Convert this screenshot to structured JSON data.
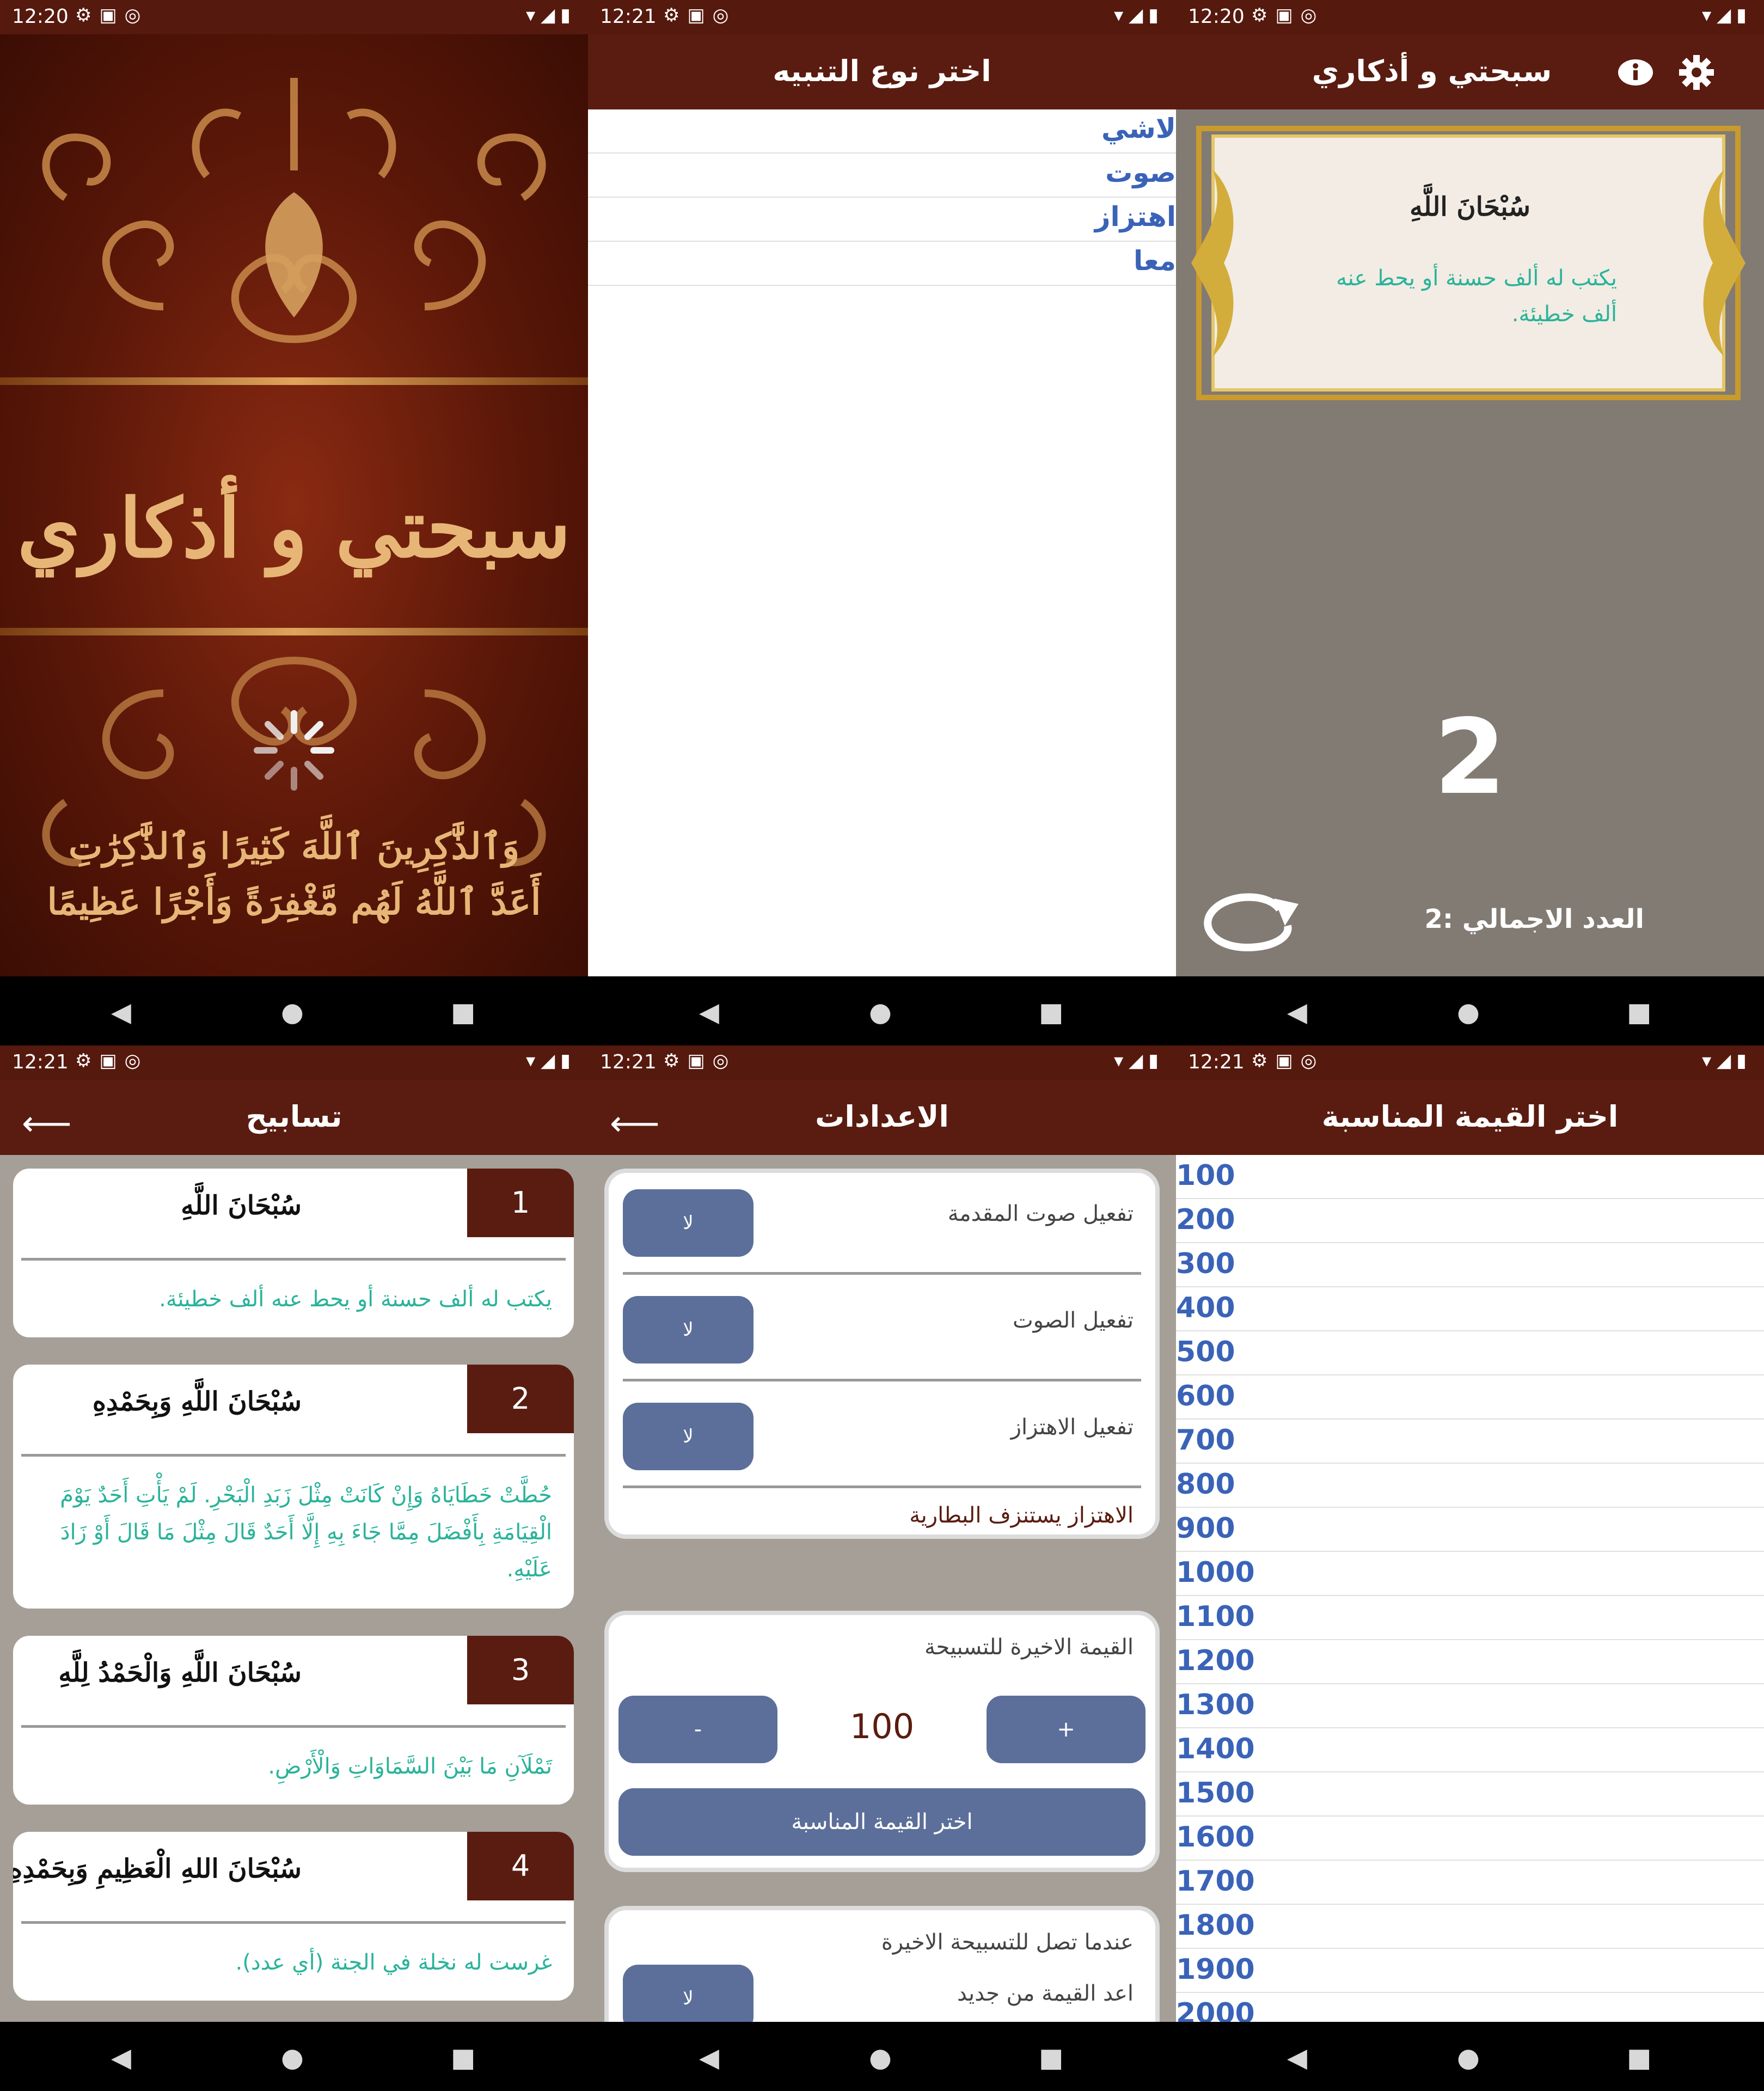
{
  "colors": {
    "brand": "#5a1c10",
    "accent_blue": "#3a63b8",
    "teal_text": "#2ab39a",
    "button_blue": "#5b6f9a",
    "gold": "#e7b676"
  },
  "status_icons": [
    "gear-icon",
    "a-icon",
    "at-icon",
    "wifi-icon",
    "signal-icon",
    "battery-icon"
  ],
  "panes": {
    "splash": {
      "time": "12:20",
      "title": "سبحتي و أذكاري",
      "verse_line1": "وَٱلذَّٰكِرِينَ ٱللَّهَ كَثِيرًا وَٱلذَّٰكِرَٰتِ",
      "verse_line2": "أَعَدَّ ٱللَّهُ لَهُم مَّغْفِرَةً وَأَجْرًا عَظِيمًا"
    },
    "alert_type": {
      "time": "12:21",
      "title": "اختر نوع التنبيه",
      "options": [
        "لاشي",
        "صوت",
        "اهتزاز",
        "معا"
      ]
    },
    "counter": {
      "time": "12:20",
      "title": "سبحتي و أذكاري",
      "zikr": "سُبْحَانَ اللَّهِ",
      "desc": "يكتب له ألف حسنة أو يحط عنه ألف خطيئة.",
      "count": "2",
      "total": "العدد الاجمالي :2"
    },
    "tasabeeh": {
      "time": "12:21",
      "title": "تسابيح",
      "cards": [
        {
          "num": "1",
          "title": "سُبْحَانَ اللَّهِ",
          "desc": "يكتب له ألف حسنة أو يحط عنه ألف خطيئة."
        },
        {
          "num": "2",
          "title": "سُبْحَانَ اللَّهِ وَبِحَمْدِهِ",
          "desc": "حُطَّتْ خَطَايَاهُ وَإِنْ كَانَتْ مِثْلَ زَبَدِ الْبَحْرِ. لَمْ يَأْتِ أَحَدٌ يَوْمَ الْقِيَامَةِ بِأَفْضَلَ مِمَّا جَاءَ بِهِ إِلَّا أَحَدٌ قَالَ مِثْلَ مَا قَالَ أَوْ زَادَ عَلَيْهِ."
        },
        {
          "num": "3",
          "title": "سُبْحَانَ اللَّهِ وَالْحَمْدُ لِلَّهِ",
          "desc": "تَمْلَآنِ مَا بَيْنَ السَّمَاوَاتِ وَالْأَرْضِ."
        },
        {
          "num": "4",
          "title": "سُبْحَانَ اللهِ الْعَظِيمِ وَبِحَمْدِهِ",
          "desc": "غرست له نخلة في الجنة (أي عدد)."
        }
      ]
    },
    "settings": {
      "time": "12:21",
      "title": "الاعدادات",
      "intro_sound": "تفعيل صوت المقدمة",
      "sound": "تفعيل الصوت",
      "vibration": "تفعيل الاهتزاز",
      "toggle_value": "لا",
      "battery_note": "الاهتزاز يستنزف البطارية",
      "last_value_label": "القيمة الاخيرة للتسبيحة",
      "minus": "-",
      "plus": "+",
      "value": "100",
      "choose_value": "اختر القيمة المناسبة",
      "reach_last": "عندما تصل للتسبيحة الاخيرة",
      "restart": "اعد القيمة من جديد"
    },
    "values_list": {
      "time": "12:21",
      "title": "اختر القيمة المناسبة",
      "values": [
        "100",
        "200",
        "300",
        "400",
        "500",
        "600",
        "700",
        "800",
        "900",
        "1000",
        "1100",
        "1200",
        "1300",
        "1400",
        "1500",
        "1600",
        "1700",
        "1800",
        "1900",
        "2000"
      ]
    }
  }
}
